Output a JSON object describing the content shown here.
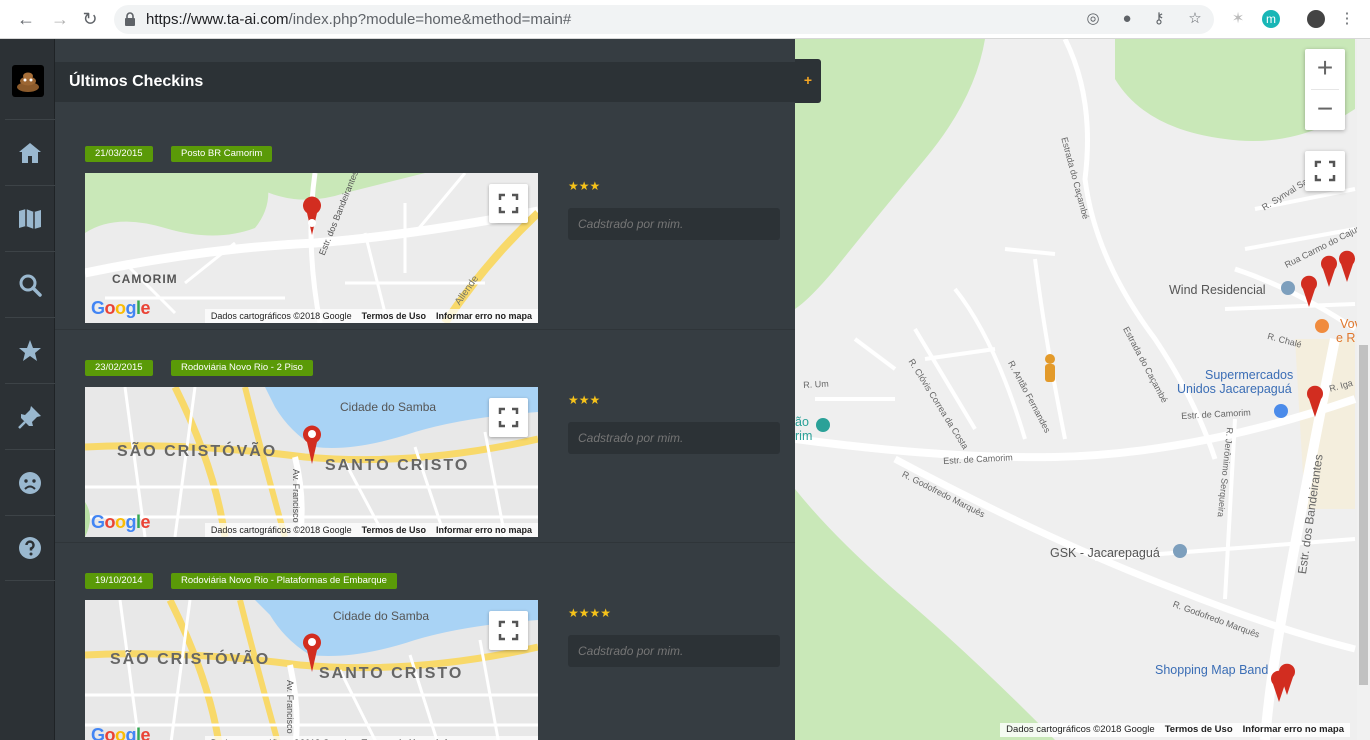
{
  "browser": {
    "url_host": "https://www.ta-ai.com",
    "url_path": "/index.php?module=home&method=main#",
    "profile_initial": "m"
  },
  "sidebar": {
    "items": [
      {
        "name": "home-icon"
      },
      {
        "name": "map-icon"
      },
      {
        "name": "search-icon"
      },
      {
        "name": "star-icon"
      },
      {
        "name": "pushpin-icon"
      },
      {
        "name": "sad-face-icon"
      },
      {
        "name": "help-icon"
      }
    ]
  },
  "panel": {
    "title": "Últimos Checkins",
    "tab_label": "+"
  },
  "checkins": [
    {
      "date": "21/03/2015",
      "place": "Posto BR Camorim",
      "stars": "★★★",
      "note_placeholder": "Cadstrado por mim.",
      "map_labels": [
        "CAMORIM",
        "Estr. dos Bandeirantes",
        "Allende"
      ]
    },
    {
      "date": "23/02/2015",
      "place": "Rodoviária Novo Rio - 2 Piso",
      "stars": "★★★",
      "note_placeholder": "Cadstrado por mim.",
      "map_labels": [
        "Cidade do Samba",
        "SÃO CRISTÓVÃO",
        "SANTO CRISTO",
        "Av. Francisco"
      ]
    },
    {
      "date": "19/10/2014",
      "place": "Rodoviária Novo Rio - Plataformas de Embarque",
      "stars": "★★★★",
      "note_placeholder": "Cadstrado por mim.",
      "map_labels": [
        "Cidade do Samba",
        "SÃO CRISTÓVÃO",
        "SANTO CRISTO",
        "Av. Francisco"
      ]
    }
  ],
  "minimap": {
    "google": "Google",
    "attribution": "Dados cartográficos ©2018 Google",
    "terms": "Termos de Uso",
    "report": "Informar erro no mapa"
  },
  "bigmap": {
    "zoom_in": "+",
    "zoom_out": "−",
    "attribution": "Dados cartográficos ©2018 Google",
    "terms": "Termos de Uso",
    "report": "Informar erro no mapa",
    "places": {
      "wind": "Wind Residencial",
      "super1": "Supermercados",
      "super2": "Unidos Jacarepaguá",
      "gsk": "GSK - Jacarepaguá",
      "shopping": "Shopping Map Band",
      "vov": "Vov",
      "er": "e R",
      "sao": "ão",
      "rim": "rim"
    },
    "streets": {
      "cacambe1": "Estrada do Caçambé",
      "cacambe2": "Estrada do Caçambé",
      "camorim1": "Estr. de Camorim",
      "camorim2": "Estr. de Camorim",
      "godofredo1": "R. Godofredo Marquês",
      "godofredo2": "R. Godofredo Marquês",
      "clovis": "R. Clóvis Correa da Costa",
      "antao": "R. Antão Fernandes",
      "jeronimo": "R. Jerônimo Serqueira",
      "bandeirantes": "Estr. dos Bandeirantes",
      "carmo": "Rua Carmo do Cajuru",
      "synval": "R. Synval Sam",
      "um": "R. Um",
      "chale": "R. Chalé",
      "iga": "R. Iga"
    }
  }
}
